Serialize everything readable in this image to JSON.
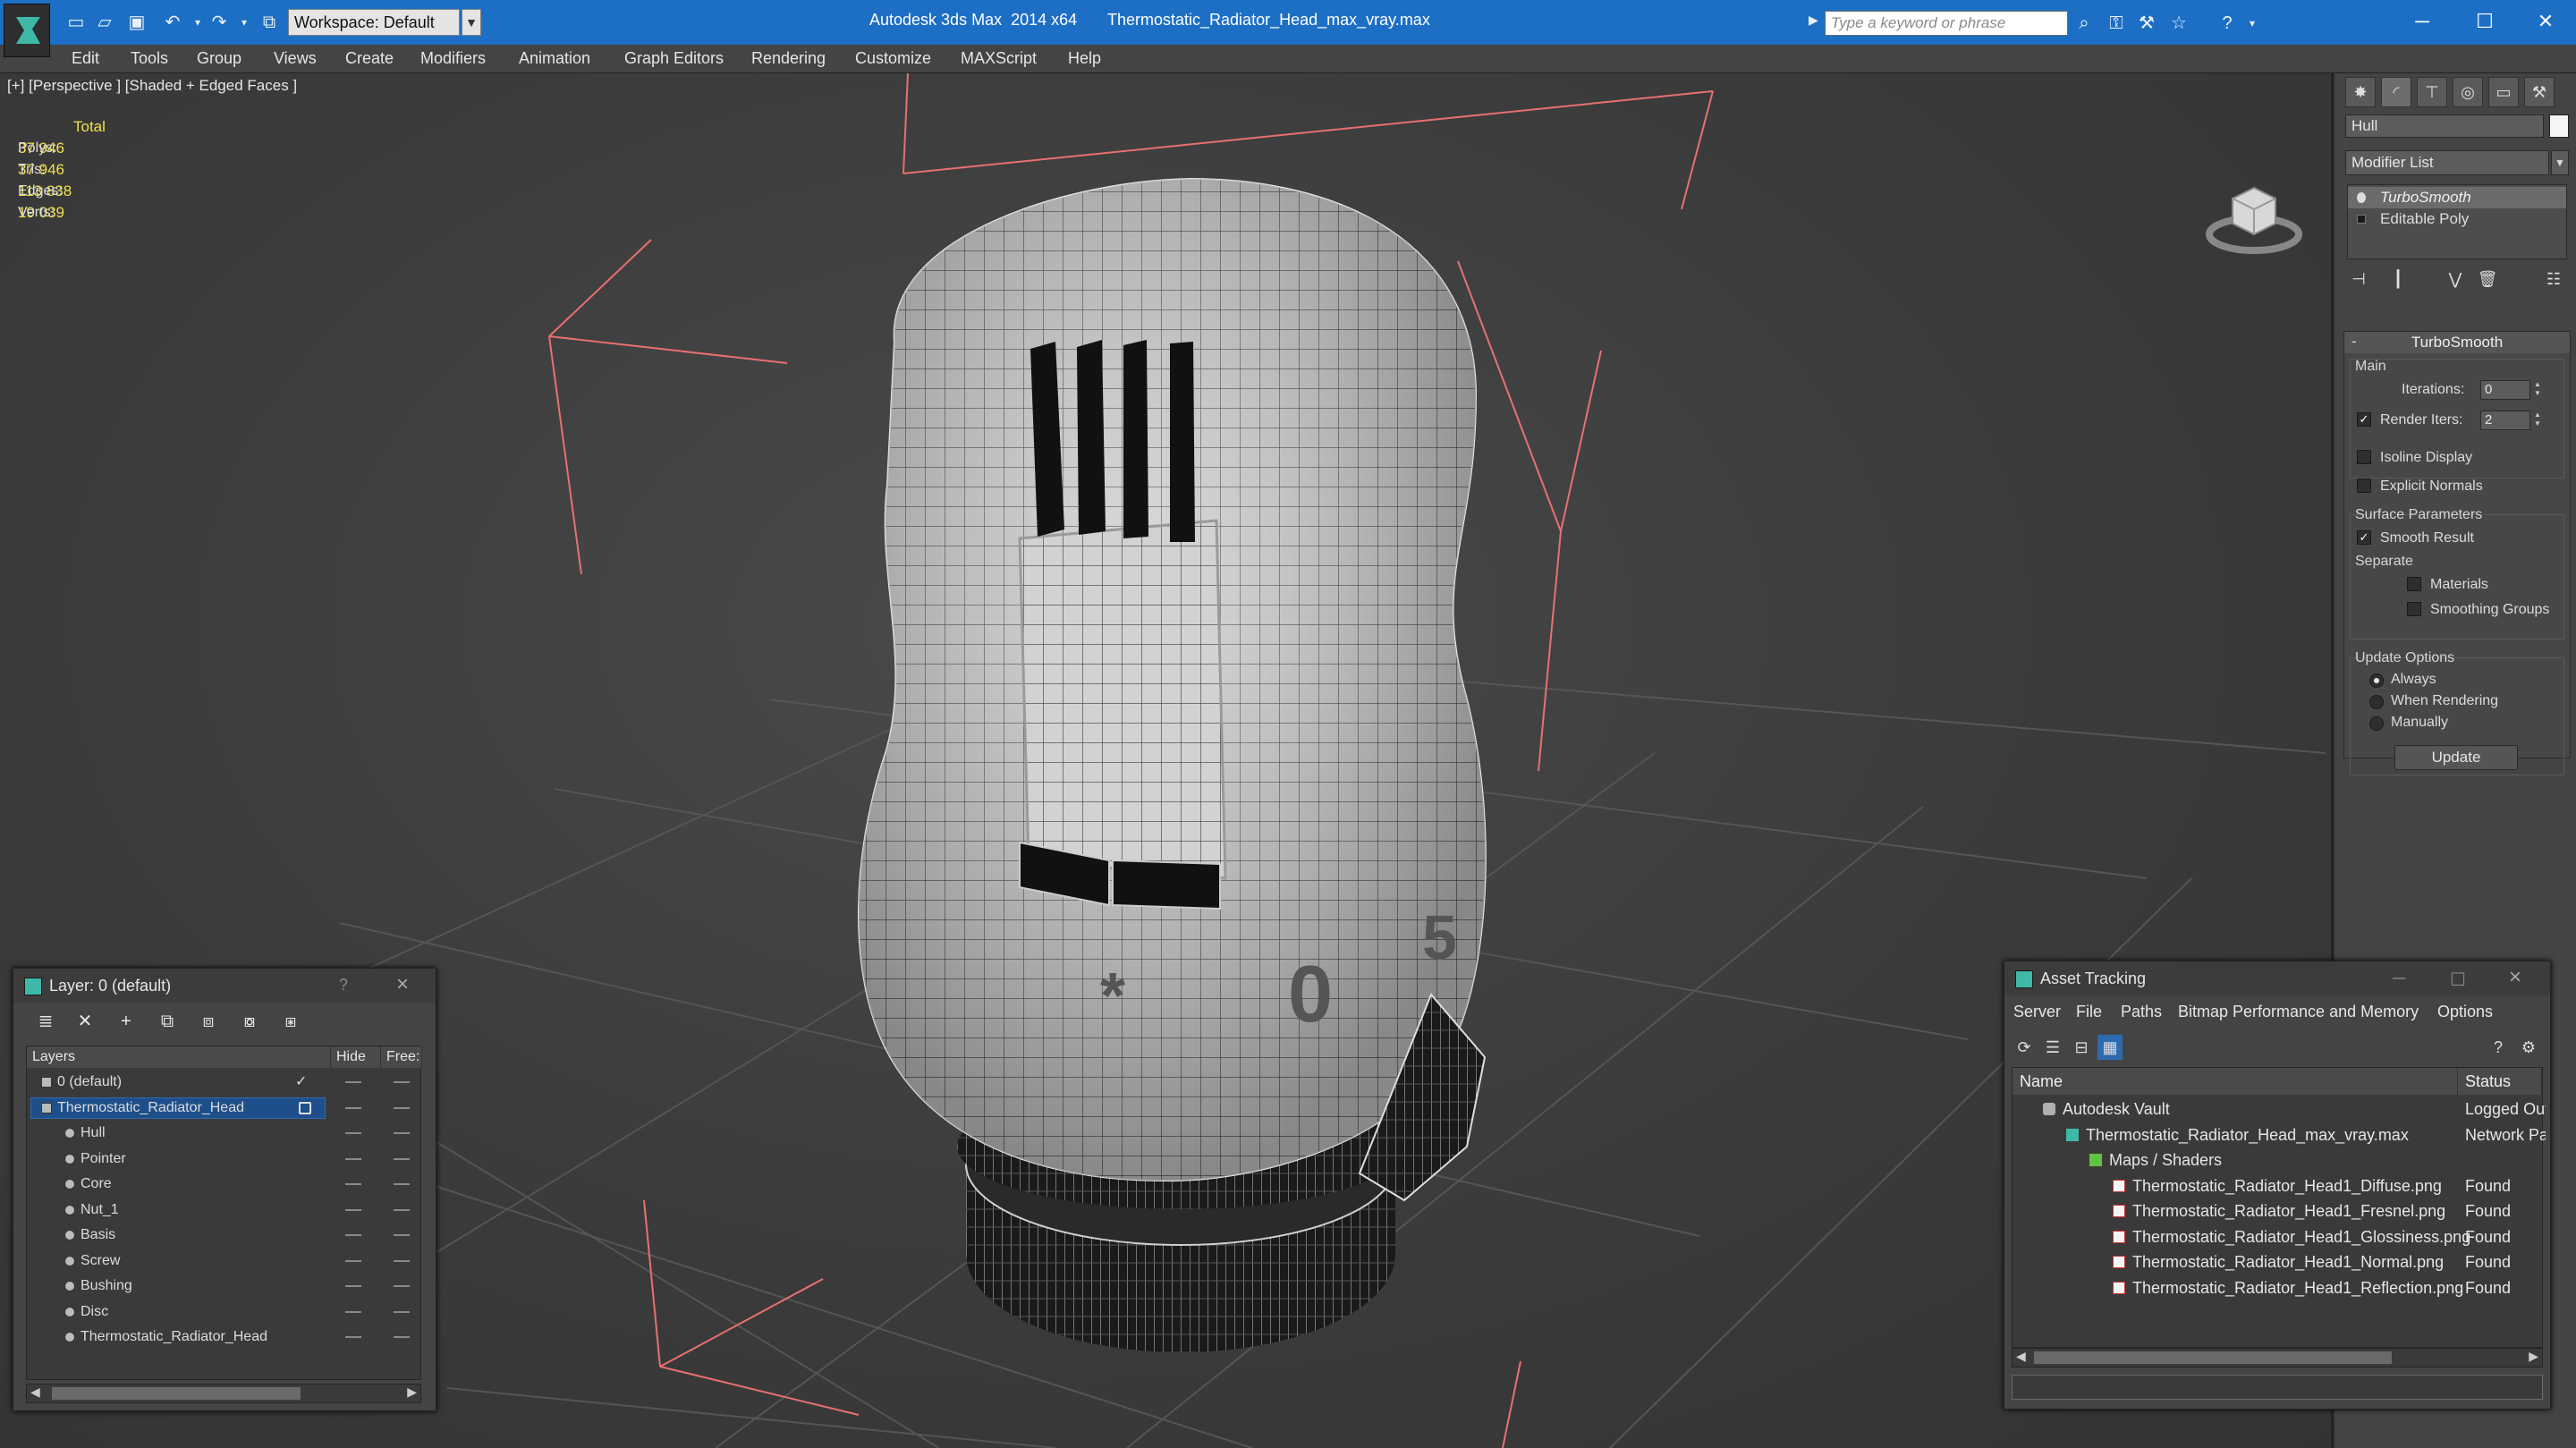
{
  "titlebar": {
    "workspace": "Workspace: Default",
    "app_title": "Autodesk 3ds Max  2014 x64",
    "file_title": "Thermostatic_Radiator_Head_max_vray.max",
    "search_placeholder": "Type a keyword or phrase"
  },
  "menu": [
    "Edit",
    "Tools",
    "Group",
    "Views",
    "Create",
    "Modifiers",
    "Animation",
    "Graph Editors",
    "Rendering",
    "Customize",
    "MAXScript",
    "Help"
  ],
  "viewport": {
    "label": "[+] [Perspective ] [Shaded + Edged Faces ]",
    "stats": {
      "header": "Total",
      "rows": [
        {
          "label": "Polys:",
          "value": "37 946"
        },
        {
          "label": "Tris:",
          "value": "37 946"
        },
        {
          "label": "Edges:",
          "value": "113 838"
        },
        {
          "label": "Verts:",
          "value": "19 039"
        }
      ]
    }
  },
  "command_panel": {
    "object_name": "Hull",
    "modifier_list": "Modifier List",
    "stack": [
      "TurboSmooth",
      "Editable Poly"
    ],
    "turbosmooth": {
      "title": "TurboSmooth",
      "main": "Main",
      "iterations_label": "Iterations:",
      "iterations_value": "0",
      "render_iters_label": "Render Iters:",
      "render_iters_value": "2",
      "isoline": "Isoline Display",
      "explicit_normals": "Explicit Normals",
      "surface_params": "Surface Parameters",
      "smooth_result": "Smooth Result",
      "separate": "Separate",
      "materials": "Materials",
      "smoothing_groups": "Smoothing Groups",
      "update_options": "Update Options",
      "always": "Always",
      "when_rendering": "When Rendering",
      "manually": "Manually",
      "update_button": "Update"
    }
  },
  "layer_panel": {
    "title": "Layer: 0 (default)",
    "help": "?",
    "col_layers": "Layers",
    "col_hide": "Hide",
    "col_freeze": "Free:",
    "rows": [
      {
        "name": "0 (default)",
        "kind": "layer",
        "indent": 0
      },
      {
        "name": "Thermostatic_Radiator_Head",
        "kind": "layer",
        "indent": 0
      },
      {
        "name": "Hull",
        "kind": "object",
        "indent": 1
      },
      {
        "name": "Pointer",
        "kind": "object",
        "indent": 1
      },
      {
        "name": "Core",
        "kind": "object",
        "indent": 1
      },
      {
        "name": "Nut_1",
        "kind": "object",
        "indent": 1
      },
      {
        "name": "Basis",
        "kind": "object",
        "indent": 1
      },
      {
        "name": "Screw",
        "kind": "object",
        "indent": 1
      },
      {
        "name": "Bushing",
        "kind": "object",
        "indent": 1
      },
      {
        "name": "Disc",
        "kind": "object",
        "indent": 1
      },
      {
        "name": "Thermostatic_Radiator_Head",
        "kind": "object",
        "indent": 1
      }
    ]
  },
  "asset_panel": {
    "title": "Asset Tracking",
    "menu": [
      "Server",
      "File",
      "Paths",
      "Bitmap Performance and Memory",
      "Options"
    ],
    "col_name": "Name",
    "col_status": "Status",
    "rows": [
      {
        "name": "Autodesk Vault",
        "status": "Logged Out",
        "icon": "vault",
        "indent": 1
      },
      {
        "name": "Thermostatic_Radiator_Head_max_vray.max",
        "status": "Network Path",
        "icon": "max",
        "indent": 2
      },
      {
        "name": "Maps / Shaders",
        "status": "",
        "icon": "maps",
        "indent": 3
      },
      {
        "name": "Thermostatic_Radiator_Head1_Diffuse.png",
        "status": "Found",
        "icon": "png",
        "indent": 4
      },
      {
        "name": "Thermostatic_Radiator_Head1_Fresnel.png",
        "status": "Found",
        "icon": "png",
        "indent": 4
      },
      {
        "name": "Thermostatic_Radiator_Head1_Glossiness.png",
        "status": "Found",
        "icon": "png",
        "indent": 4
      },
      {
        "name": "Thermostatic_Radiator_Head1_Normal.png",
        "status": "Found",
        "icon": "png",
        "indent": 4
      },
      {
        "name": "Thermostatic_Radiator_Head1_Reflection.png",
        "status": "Found",
        "icon": "png",
        "indent": 4
      }
    ]
  },
  "colors": {
    "titlebar": "#1c6fc4",
    "selection": "#1f4f8a",
    "stats_text": "#f1e04a"
  }
}
